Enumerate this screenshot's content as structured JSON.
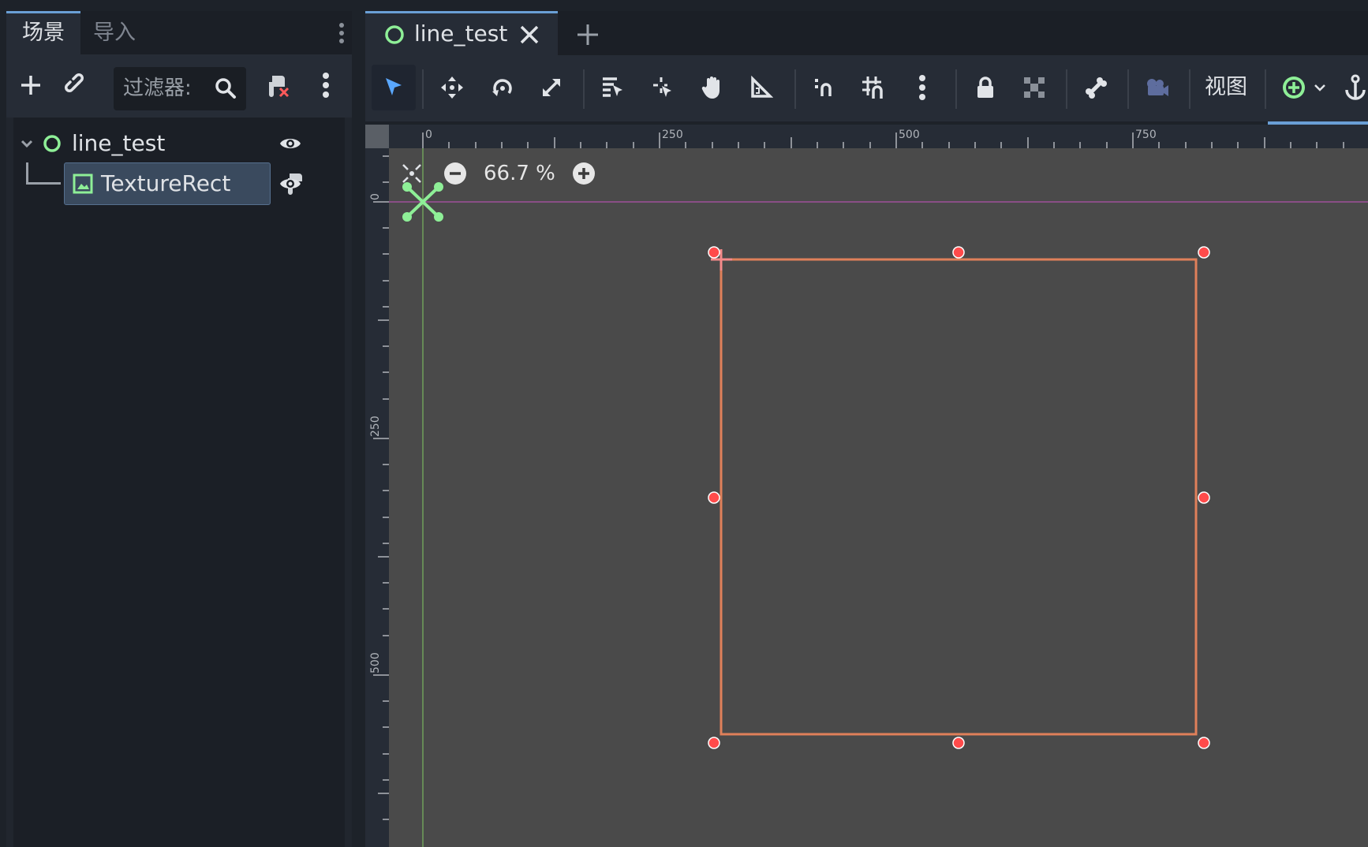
{
  "left_dock": {
    "tabs": [
      "场景",
      "导入"
    ],
    "filter_placeholder": "过滤器:",
    "tree": {
      "root_name": "line_test",
      "child_name": "TextureRect"
    }
  },
  "editor": {
    "tab_title": "line_test",
    "view_menu_label": "视图",
    "zoom": "66.7 %",
    "ruler_top_labels": [
      "0",
      "250",
      "500",
      "750"
    ],
    "ruler_left_labels": [
      "0",
      "250",
      "500"
    ]
  },
  "colors": {
    "accent": "#6a9fd6",
    "node_green": "#8eef97",
    "selection_rect": "#e0805a",
    "handle_red": "#ff4b4b",
    "canvas_bg": "#4a4a4a"
  }
}
